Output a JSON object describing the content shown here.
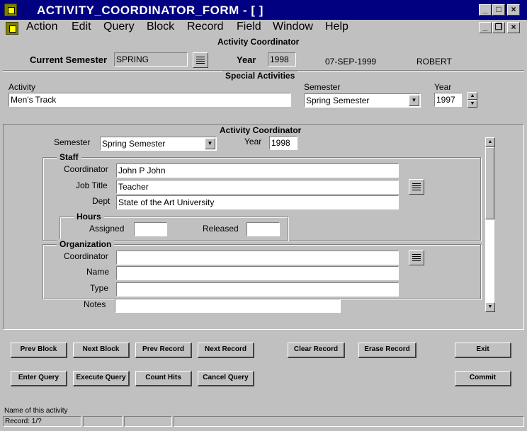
{
  "window": {
    "title": "ACTIVITY_COORDINATOR_FORM - [ ]",
    "min": "_",
    "max": "□",
    "close": "×",
    "mdi_min": "_",
    "mdi_restore": "❐",
    "mdi_close": "×"
  },
  "menu": [
    "Action",
    "Edit",
    "Query",
    "Block",
    "Record",
    "Field",
    "Window",
    "Help"
  ],
  "header": {
    "title": "Activity Coordinator",
    "current_semester_label": "Current Semester",
    "current_semester_value": "SPRING",
    "year_label": "Year",
    "year_value": "1998",
    "date": "07-SEP-1999",
    "user": "ROBERT"
  },
  "special": {
    "title": "Special Activities",
    "activity_label": "Activity",
    "activity_value": "Men's Track",
    "semester_label": "Semester",
    "semester_value": "Spring Semester",
    "year_label": "Year",
    "year_value": "1997"
  },
  "coordinator": {
    "title": "Activity Coordinator",
    "semester_label": "Semester",
    "semester_value": "Spring Semester",
    "year_label": "Year",
    "year_value": "1998",
    "staff": {
      "title": "Staff",
      "coordinator_label": "Coordinator",
      "coordinator_value": "John P John",
      "job_title_label": "Job Title",
      "job_title_value": "Teacher",
      "dept_label": "Dept",
      "dept_value": "State of the Art University"
    },
    "hours": {
      "title": "Hours",
      "assigned_label": "Assigned",
      "assigned_value": "",
      "released_label": "Released",
      "released_value": ""
    },
    "org": {
      "title": "Organization",
      "coordinator_label": "Coordinator",
      "coordinator_value": "",
      "name_label": "Name",
      "name_value": "",
      "type_label": "Type",
      "type_value": ""
    },
    "notes_label": "Notes",
    "notes_value": ""
  },
  "buttons": {
    "prev_block": "Prev Block",
    "next_block": "Next Block",
    "prev_record": "Prev Record",
    "next_record": "Next Record",
    "clear_record": "Clear Record",
    "erase_record": "Erase Record",
    "exit": "Exit",
    "enter_query": "Enter Query",
    "execute_query": "Execute Query",
    "count_hits": "Count Hits",
    "cancel_query": "Cancel Query",
    "commit": "Commit"
  },
  "status": {
    "message": "Name of this activity",
    "record": "Record: 1/?"
  }
}
